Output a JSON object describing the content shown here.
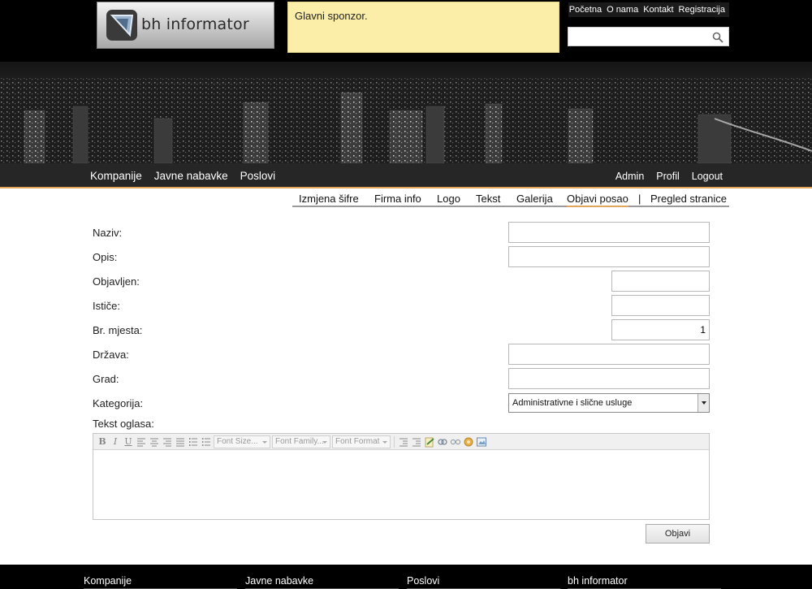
{
  "header": {
    "logo_text": "bh informator",
    "sponsor_text": "Glavni sponzor.",
    "top_links": [
      "Početna",
      "O nama",
      "Kontakt",
      "Registracija"
    ],
    "search": {
      "value": "",
      "placeholder": ""
    }
  },
  "main_nav": {
    "left": [
      "Kompanije",
      "Javne nabavke",
      "Poslovi"
    ],
    "right": [
      "Admin",
      "Profil",
      "Logout"
    ],
    "accent": "#e2a55a"
  },
  "sub_tabs": {
    "items": [
      "Izmjena šifre",
      "Firma info",
      "Logo",
      "Tekst",
      "Galerija",
      "Objavi posao",
      "Pregled stranice"
    ],
    "active": "Objavi posao",
    "separator": "|"
  },
  "form": {
    "naziv": {
      "label": "Naziv:",
      "value": ""
    },
    "opis": {
      "label": "Opis:",
      "value": ""
    },
    "objavljen": {
      "label": "Objavljen:",
      "value": ""
    },
    "istice": {
      "label": "Ističe:",
      "value": ""
    },
    "br_mjesta": {
      "label": "Br. mjesta:",
      "value": "1"
    },
    "drzava": {
      "label": "Država:",
      "value": ""
    },
    "grad": {
      "label": "Grad:",
      "value": ""
    },
    "kategorija": {
      "label": "Kategorija:",
      "selected": "Administrativne i slične usluge"
    },
    "tekst_oglasa": {
      "label": "Tekst oglasa:"
    },
    "submit_label": "Objavi"
  },
  "editor_toolbar": {
    "bold": "B",
    "italic": "I",
    "underline": "U",
    "font_size": "Font Size...",
    "font_family": "Font Family...",
    "font_format": "Font Format"
  },
  "footer": {
    "columns": [
      "Kompanije",
      "Javne nabavke",
      "Poslovi",
      "bh informator"
    ]
  }
}
